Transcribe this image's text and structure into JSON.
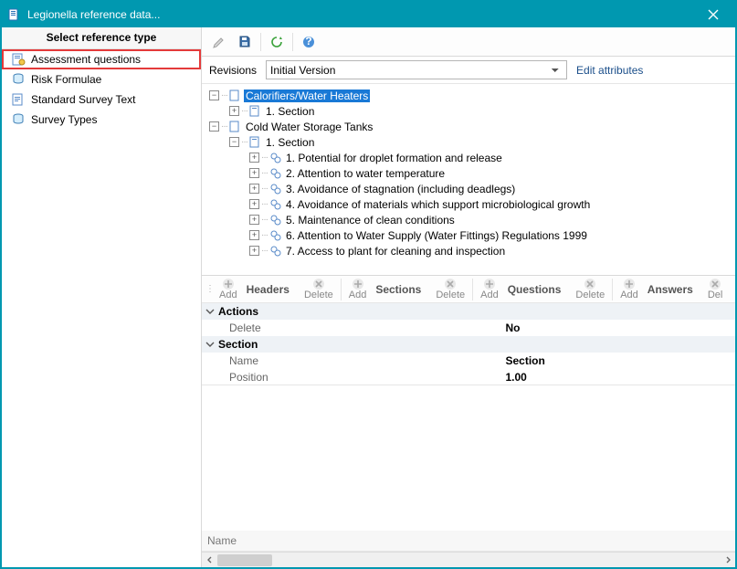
{
  "window": {
    "title": "Legionella reference data..."
  },
  "sidebar": {
    "header": "Select reference type",
    "items": [
      {
        "label": "Assessment questions",
        "highlight": true
      },
      {
        "label": "Risk Formulae"
      },
      {
        "label": "Standard Survey Text"
      },
      {
        "label": "Survey Types"
      }
    ]
  },
  "revisions": {
    "label": "Revisions",
    "selected": "Initial Version",
    "edit_link": "Edit attributes"
  },
  "tree": {
    "n0": "Calorifiers/Water Heaters",
    "n0_0": "1. Section",
    "n1": "Cold Water Storage Tanks",
    "n1_0": "1. Section",
    "n1_0_0": "1. Potential for droplet formation and release",
    "n1_0_1": "2. Attention to water temperature",
    "n1_0_2": "3. Avoidance of stagnation (including deadlegs)",
    "n1_0_3": "4. Avoidance of materials which support microbiological growth",
    "n1_0_4": "5. Maintenance of clean conditions",
    "n1_0_5": "6. Attention to Water Supply (Water Fittings) Regulations 1999",
    "n1_0_6": "7. Access to plant for cleaning and inspection"
  },
  "cmd": {
    "headers": "Headers",
    "sections": "Sections",
    "questions": "Questions",
    "answers": "Answers",
    "add": "Add",
    "delete": "Delete",
    "del_short": "Del"
  },
  "props": {
    "g1": "Actions",
    "g1_delete_k": "Delete",
    "g1_delete_v": "No",
    "g2": "Section",
    "g2_name_k": "Name",
    "g2_name_v": "Section",
    "g2_pos_k": "Position",
    "g2_pos_v": "1.00"
  },
  "grid": {
    "col0": "Name"
  }
}
